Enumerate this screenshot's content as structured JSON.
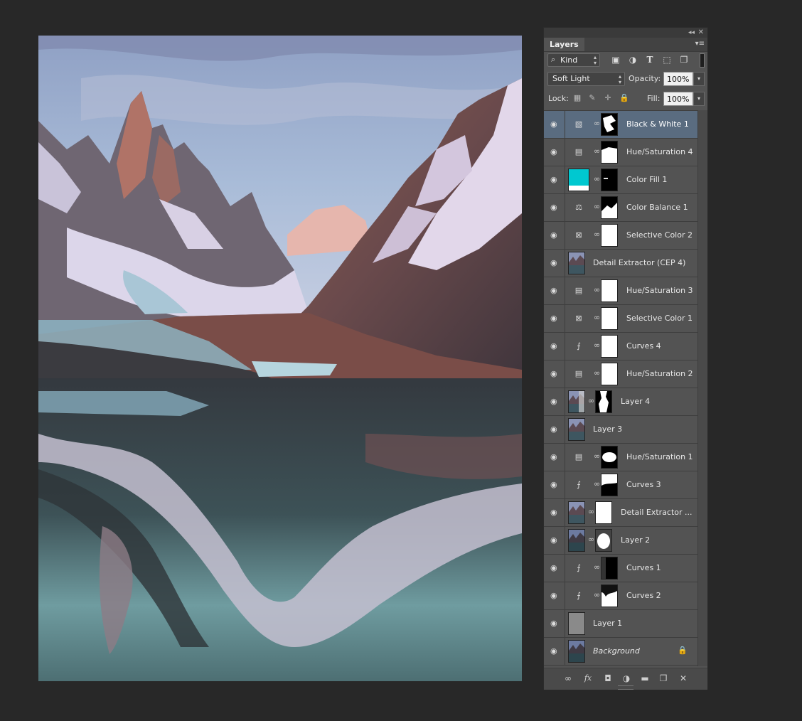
{
  "canvas": {
    "image_description_name": "mountain-reflection-photo"
  },
  "panel": {
    "tab_label": "Layers",
    "collapse_icon": "double-chevron-left-icon",
    "close_icon": "close-icon",
    "menu_icon": "panel-menu-icon",
    "kind_filter": {
      "label": "Kind",
      "filter_icons": [
        "image-filter-icon",
        "adjustment-filter-icon",
        "type-filter-icon",
        "shape-filter-icon",
        "smart-object-filter-icon"
      ]
    },
    "blend_mode": "Soft Light",
    "opacity_label": "Opacity:",
    "opacity_value": "100%",
    "lock_label": "Lock:",
    "lock_icons": [
      "lock-transparent-icon",
      "lock-image-icon",
      "lock-position-icon",
      "lock-all-icon"
    ],
    "fill_label": "Fill:",
    "fill_value": "100%",
    "selected_color": "#5a6c80",
    "layers": [
      {
        "name": "Black & White 1",
        "type": "adjustment",
        "icon": "black-white-icon",
        "mask": "black-shape",
        "selected": true
      },
      {
        "name": "Hue/Saturation 4",
        "type": "adjustment",
        "icon": "hue-saturation-icon",
        "mask": "white-top-dark"
      },
      {
        "name": "Color Fill 1",
        "type": "fill",
        "icon": "color-fill-swatch",
        "fill_color": "#00c8d0",
        "mask": "black-mostly"
      },
      {
        "name": "Color Balance 1",
        "type": "adjustment",
        "icon": "color-balance-icon",
        "mask": "black-bottom-white"
      },
      {
        "name": "Selective Color 2",
        "type": "adjustment",
        "icon": "selective-color-icon",
        "mask": "white"
      },
      {
        "name": "Detail Extractor (CEP 4)",
        "type": "pixel",
        "icon": "photo-thumb"
      },
      {
        "name": "Hue/Saturation 3",
        "type": "adjustment",
        "icon": "hue-saturation-icon",
        "mask": "white"
      },
      {
        "name": "Selective Color 1",
        "type": "adjustment",
        "icon": "selective-color-icon",
        "mask": "white"
      },
      {
        "name": "Curves 4",
        "type": "adjustment",
        "icon": "curves-icon",
        "mask": "white"
      },
      {
        "name": "Hue/Saturation 2",
        "type": "adjustment",
        "icon": "hue-saturation-icon",
        "mask": "white"
      },
      {
        "name": "Layer 4",
        "type": "pixel-masked",
        "icon": "photo-thumb",
        "mask": "white-with-black-sides"
      },
      {
        "name": "Layer 3",
        "type": "pixel",
        "icon": "photo-thumb"
      },
      {
        "name": "Hue/Saturation 1",
        "type": "adjustment",
        "icon": "hue-saturation-icon",
        "mask": "black-top-white-mid"
      },
      {
        "name": "Curves 3",
        "type": "adjustment",
        "icon": "curves-icon",
        "mask": "white-bottom-black"
      },
      {
        "name": "Detail Extractor ...",
        "type": "pixel-masked",
        "icon": "photo-thumb",
        "mask": "white"
      },
      {
        "name": "Layer 2",
        "type": "pixel-masked",
        "icon": "photo-thumb",
        "mask": "white-blurred-center"
      },
      {
        "name": "Curves 1",
        "type": "adjustment",
        "icon": "curves-icon",
        "mask": "black-soft"
      },
      {
        "name": "Curves 2",
        "type": "adjustment",
        "icon": "curves-icon",
        "mask": "white-top-dark-blob"
      },
      {
        "name": "Layer 1",
        "type": "gray",
        "icon": "gray-thumb"
      },
      {
        "name": "Background",
        "type": "background",
        "icon": "photo-thumb",
        "locked": true
      }
    ],
    "bottom_icons": [
      "link-layers-icon",
      "fx-icon",
      "add-mask-icon",
      "new-adjustment-icon",
      "new-group-folder-icon",
      "new-layer-icon",
      "trash-icon"
    ]
  }
}
